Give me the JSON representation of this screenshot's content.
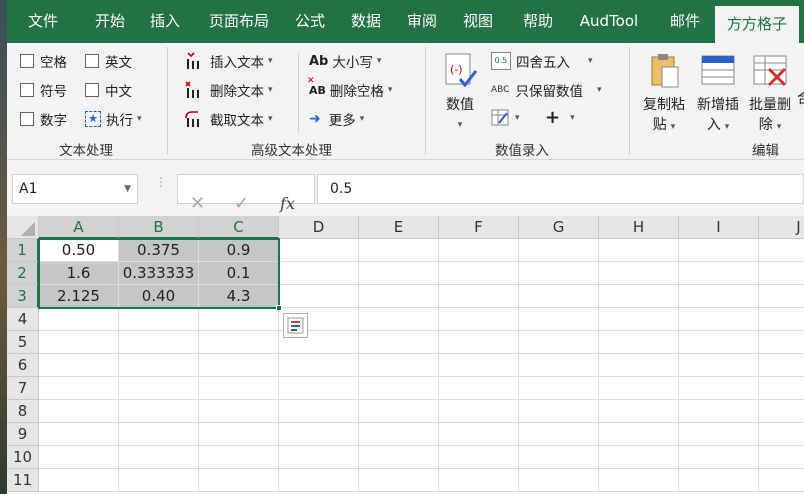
{
  "ribbon_tabs": [
    {
      "label": "文件",
      "active": false
    },
    {
      "label": "开始",
      "active": false
    },
    {
      "label": "插入",
      "active": false
    },
    {
      "label": "页面布局",
      "active": false
    },
    {
      "label": "公式",
      "active": false
    },
    {
      "label": "数据",
      "active": false
    },
    {
      "label": "审阅",
      "active": false
    },
    {
      "label": "视图",
      "active": false
    },
    {
      "label": "帮助",
      "active": false
    },
    {
      "label": "AudTool",
      "active": false
    },
    {
      "label": "邮件",
      "active": false
    },
    {
      "label": "方方格子",
      "active": true
    }
  ],
  "text_group": {
    "label": "文本处理",
    "options": [
      "空格",
      "英文",
      "符号",
      "中文",
      "数字"
    ],
    "execute_label": "执行"
  },
  "adv_text_group": {
    "label": "高级文本处理",
    "insert_text": "插入文本",
    "delete_text": "删除文本",
    "cut_text": "截取文本",
    "case_icon_text": "Ab",
    "case": "大小写",
    "delete_spaces_icon_text": "AB",
    "delete_spaces": "删除空格",
    "more": "更多"
  },
  "value_group": {
    "label": "数值录入",
    "value_button": "数值",
    "round_icon_text": "0.5",
    "round": "四舍五入",
    "keep_icon_text": "ABC",
    "keep_values": "只保留数值",
    "plus": "+"
  },
  "edit_group": {
    "label": "编辑",
    "copy_paste": [
      "复制粘",
      "贴"
    ],
    "new_insert": [
      "新增插",
      "入"
    ],
    "batch_delete": [
      "批量删",
      "除"
    ],
    "partial": "合"
  },
  "formula_bar": {
    "name_box": "A1",
    "fx": "fx",
    "formula": "0.5"
  },
  "sheet": {
    "columns": [
      "A",
      "B",
      "C",
      "D",
      "E",
      "F",
      "G",
      "H",
      "I",
      "J"
    ],
    "rows": [
      "1",
      "2",
      "3",
      "4",
      "5",
      "6",
      "7",
      "8",
      "9",
      "10",
      "11"
    ],
    "cells": [
      [
        "0.50",
        "0.375",
        "0.9"
      ],
      [
        "1.6",
        "0.333333",
        "0.1"
      ],
      [
        "2.125",
        "0.40",
        "4.3"
      ]
    ],
    "selected_range": "A1:C3",
    "active_cell": "A1"
  },
  "colors": {
    "accent": "#217346",
    "ribbon_bg": "#f3f3f3",
    "selection_shade": "#c6c6c6"
  }
}
